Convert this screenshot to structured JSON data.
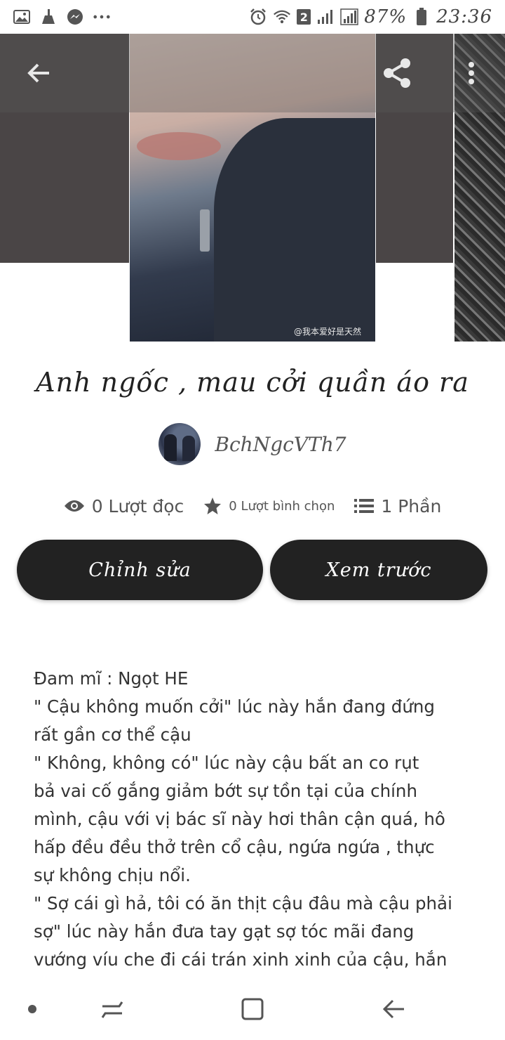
{
  "status_bar": {
    "battery_percent": "87%",
    "time": "23:36",
    "sim_badge": "2",
    "left_icons": [
      "gallery-icon",
      "cleaner-icon",
      "messenger-icon",
      "more-dots-icon"
    ],
    "right_icons": [
      "alarm-icon",
      "wifi-icon",
      "signal-icon",
      "signal-icon",
      "battery-icon"
    ]
  },
  "cover": {
    "watermark": "@我本爱好是天然"
  },
  "story": {
    "title": "Anh ngốc , mau cởi quần áo ra",
    "author": "BchNgcVTh7"
  },
  "stats": {
    "reads": "0 Lượt đọc",
    "votes": "0 Lượt bình chọn",
    "parts": "1 Phần"
  },
  "buttons": {
    "edit": "Chỉnh sửa",
    "preview": "Xem trước"
  },
  "description": [
    "Đam mĩ : Ngọt HE",
    "\" Cậu không muốn cởi\" lúc này hắn đang đứng",
    "rất gần cơ thể cậu",
    "\" Không, không có\" lúc này cậu bất an co rụt",
    "bả vai cố gắng giảm bớt sự tồn tại của chính",
    "mình, cậu với vị bác sĩ này hơi thân cận quá, hô",
    "hấp đều đều thở trên cổ cậu, ngứa ngứa , thực",
    "sự không chịu nổi.",
    "\" Sợ cái gì hả, tôi có ăn thịt cậu đâu mà cậu phải",
    "sợ\" lúc này hắn đưa tay gạt sợ tóc mãi đang",
    "vướng víu che đi cái trán xinh xinh của cậu, hắn"
  ],
  "colors": {
    "button_bg": "#222222",
    "button_text": "#ffffff",
    "text": "#333333"
  }
}
